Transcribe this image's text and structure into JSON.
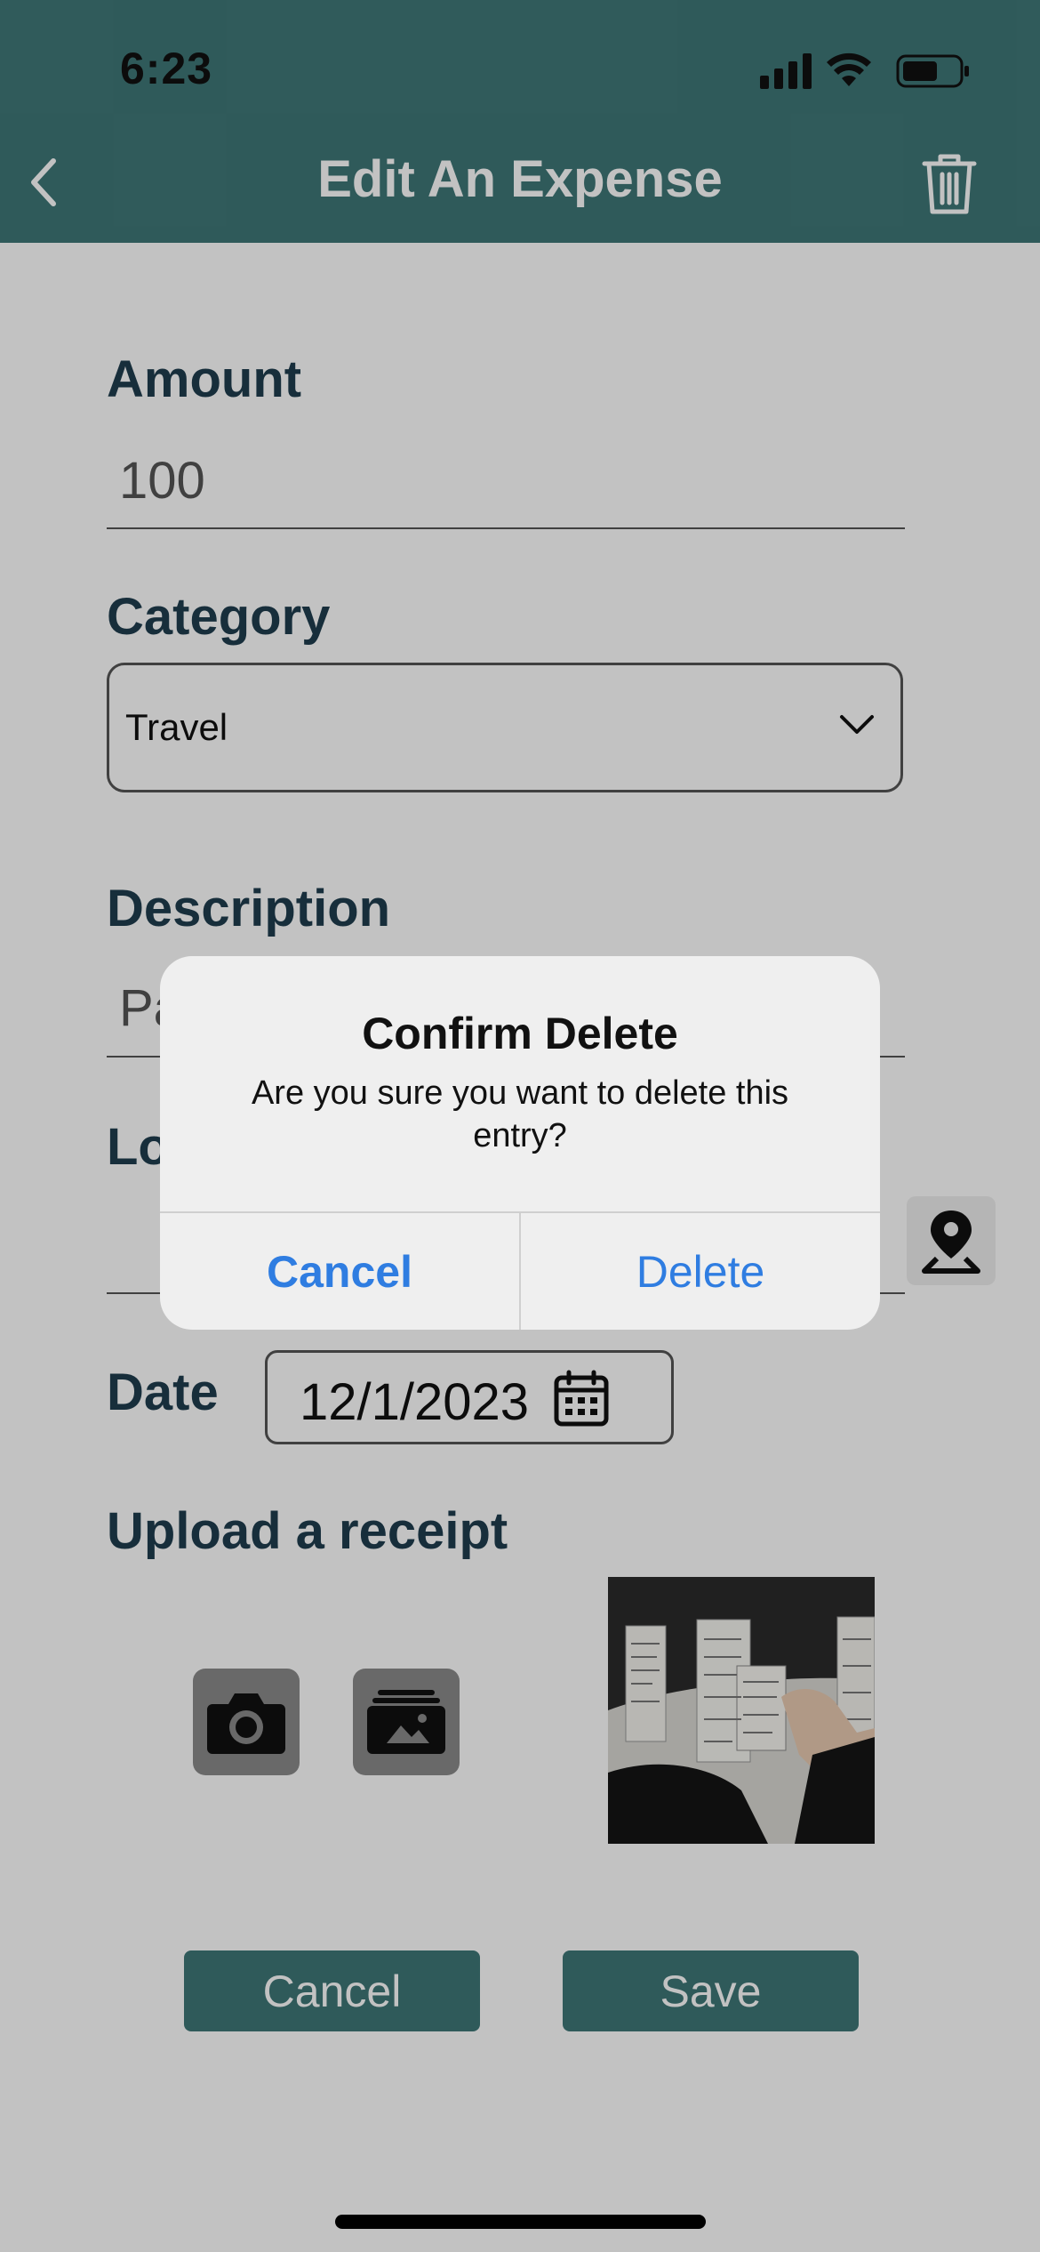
{
  "status_bar": {
    "time": "6:23"
  },
  "header": {
    "title": "Edit An Expense",
    "accent": "#3f7777"
  },
  "form": {
    "amount": {
      "label": "Amount",
      "value": "100"
    },
    "category": {
      "label": "Category",
      "value": "Travel"
    },
    "description": {
      "label": "Description",
      "value_visible": "Pa"
    },
    "location": {
      "label_visible": "Lo"
    },
    "date": {
      "label": "Date",
      "value": "12/1/2023"
    },
    "receipt": {
      "label": "Upload a receipt"
    }
  },
  "buttons": {
    "cancel": "Cancel",
    "save": "Save"
  },
  "dialog": {
    "title": "Confirm Delete",
    "message": "Are you sure you want to delete this entry?",
    "cancel": "Cancel",
    "delete": "Delete",
    "button_color": "#2f7de1"
  },
  "icons": [
    "chevron-left-icon",
    "trash-icon",
    "chevron-down-icon",
    "location-pin-icon",
    "calendar-icon",
    "camera-icon",
    "photo-library-icon"
  ]
}
